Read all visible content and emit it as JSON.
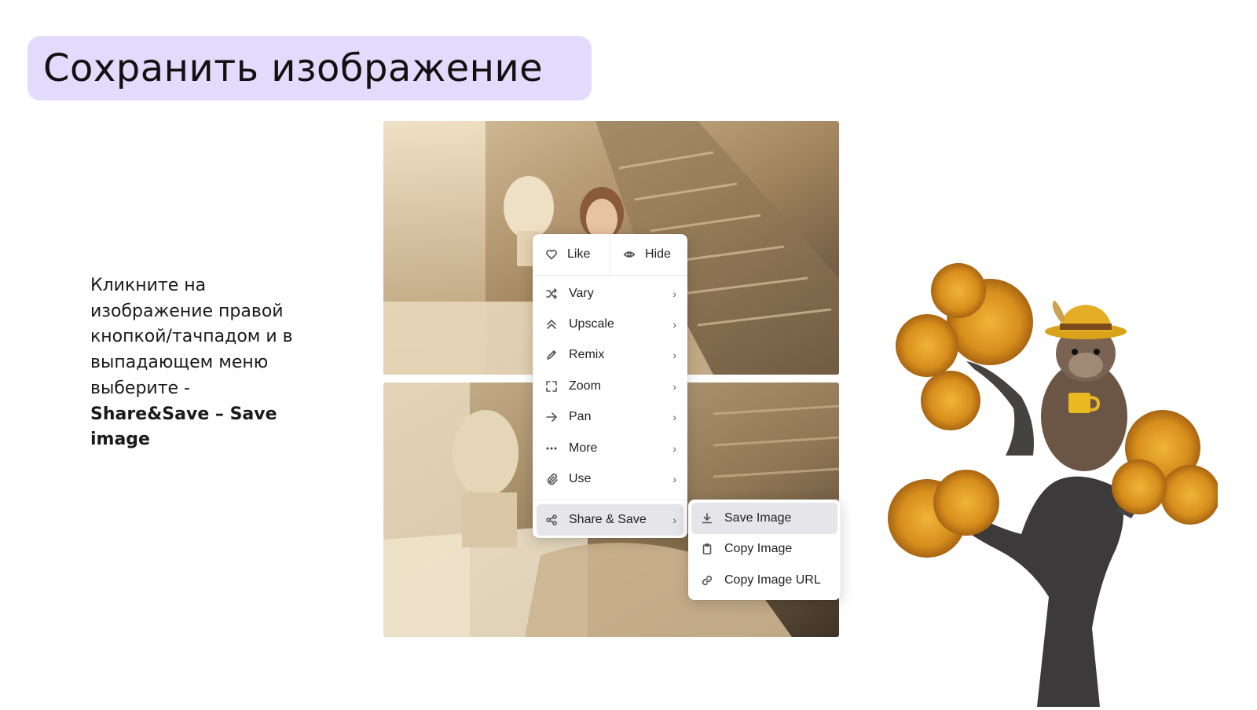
{
  "slide": {
    "title": "Сохранить изображение",
    "instruction_lines": [
      "Кликните на",
      "изображение правой",
      "кнопкой/тачпадом и в",
      "выпадающем меню",
      "выберите -"
    ],
    "instruction_bold_lines": [
      "Share&Save – Save",
      "image"
    ]
  },
  "context_menu": {
    "like_label": "Like",
    "hide_label": "Hide",
    "items": [
      {
        "label": "Vary",
        "icon": "shuffle-icon"
      },
      {
        "label": "Upscale",
        "icon": "chevrons-up-icon"
      },
      {
        "label": "Remix",
        "icon": "pencil-icon"
      },
      {
        "label": "Zoom",
        "icon": "expand-icon"
      },
      {
        "label": "Pan",
        "icon": "arrow-right-icon"
      },
      {
        "label": "More",
        "icon": "dots-icon"
      },
      {
        "label": "Use",
        "icon": "paperclip-icon"
      }
    ],
    "share_label": "Share & Save",
    "chevron": "›"
  },
  "submenu": {
    "items": [
      {
        "label": "Save Image",
        "icon": "download-icon"
      },
      {
        "label": "Copy Image",
        "icon": "clipboard-icon"
      },
      {
        "label": "Copy Image URL",
        "icon": "link-icon"
      }
    ]
  },
  "colors": {
    "title_bg": "#e3dafc",
    "menu_active_bg": "#e6e6ea"
  }
}
